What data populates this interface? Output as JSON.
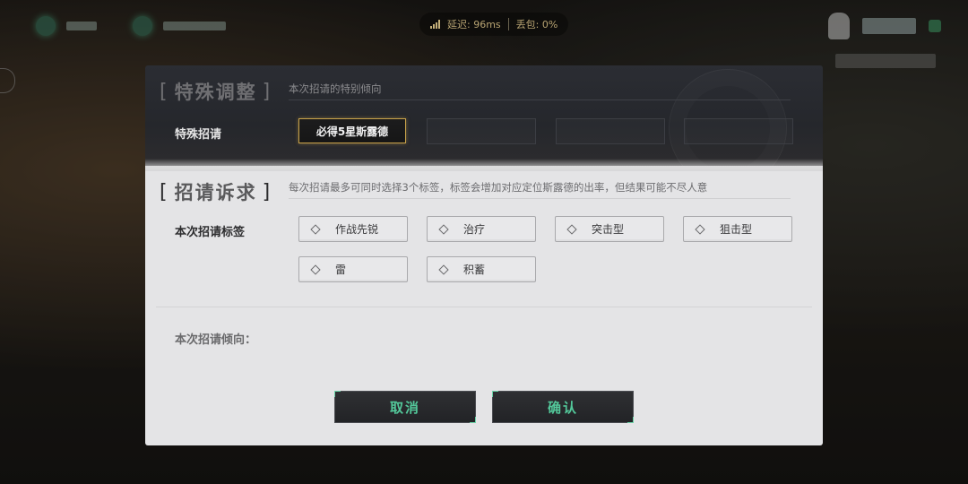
{
  "status_bar": {
    "latency": "延迟: 96ms",
    "packet_loss": "丢包: 0%",
    "signal_icon": "signal-icon"
  },
  "dialog": {
    "special_section": {
      "title": "特殊调整",
      "description": "本次招请的特别倾向",
      "row_label": "特殊招请",
      "selected_option": "必得5星斯露德",
      "empty_slots": 3
    },
    "demand_section": {
      "title": "招请诉求",
      "description": "每次招请最多可同时选择3个标签，标签会增加对应定位斯露德的出率，但结果可能不尽人意",
      "row_label": "本次招请标签",
      "tags": [
        {
          "label": "作战先锐",
          "selected": false
        },
        {
          "label": "治疗",
          "selected": false
        },
        {
          "label": "突击型",
          "selected": false
        },
        {
          "label": "狙击型",
          "selected": false
        },
        {
          "label": "雷",
          "selected": false
        },
        {
          "label": "积蓄",
          "selected": false
        }
      ]
    },
    "tendency_label": "本次招请倾向：",
    "buttons": {
      "cancel": "取消",
      "confirm": "确认"
    }
  },
  "colors": {
    "accent_green": "#53c89a",
    "selected_gold": "#c8a24a",
    "status_text": "#b8a472"
  }
}
